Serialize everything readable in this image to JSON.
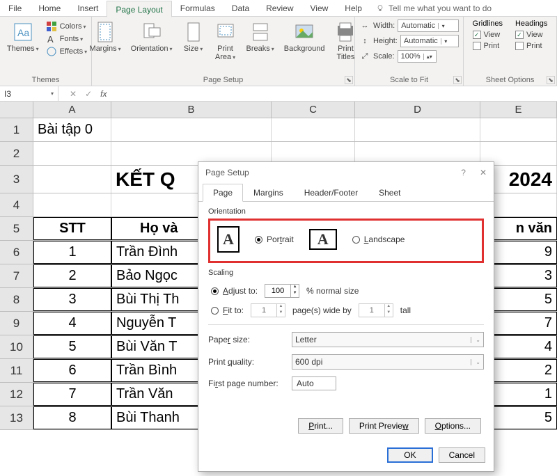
{
  "tabs": {
    "file": "File",
    "home": "Home",
    "insert": "Insert",
    "page_layout": "Page Layout",
    "formulas": "Formulas",
    "data": "Data",
    "review": "Review",
    "view": "View",
    "help": "Help",
    "tell_me": "Tell me what you want to do"
  },
  "ribbon": {
    "themes": {
      "themes_btn": "Themes",
      "colors": "Colors",
      "fonts": "Fonts",
      "effects": "Effects",
      "group": "Themes"
    },
    "page_setup": {
      "margins": "Margins",
      "orientation": "Orientation",
      "size": "Size",
      "print_area": "Print\nArea",
      "breaks": "Breaks",
      "background": "Background",
      "print_titles": "Print\nTitles",
      "group": "Page Setup"
    },
    "scale": {
      "width_lbl": "Width:",
      "width_val": "Automatic",
      "height_lbl": "Height:",
      "height_val": "Automatic",
      "scale_lbl": "Scale:",
      "scale_val": "100%",
      "group": "Scale to Fit"
    },
    "sheet_opts": {
      "gridlines": "Gridlines",
      "headings": "Headings",
      "view": "View",
      "print": "Print",
      "group": "Sheet Options"
    }
  },
  "formula_bar": {
    "namebox": "I3",
    "fx": "fx"
  },
  "cols": [
    "A",
    "B",
    "C",
    "D",
    "E"
  ],
  "rows": [
    "1",
    "2",
    "3",
    "4",
    "5",
    "6",
    "7",
    "8",
    "9",
    "10",
    "11",
    "12",
    "13"
  ],
  "cells": {
    "a1": "Bài tập 0",
    "title_left": "KẾT Q",
    "title_right": "2024",
    "hdr_stt": "STT",
    "hdr_ho": "Họ và",
    "hdr_van": "n văn",
    "data": [
      {
        "stt": "1",
        "ho": "Trần Đình",
        "v": "9"
      },
      {
        "stt": "2",
        "ho": "Bảo Ngọc",
        "v": "3"
      },
      {
        "stt": "3",
        "ho": "Bùi Thị Th",
        "v": "5"
      },
      {
        "stt": "4",
        "ho": "Nguyễn T",
        "v": "7"
      },
      {
        "stt": "5",
        "ho": "Bùi Văn T",
        "v": "4"
      },
      {
        "stt": "6",
        "ho": "Trần Bình",
        "v": "2"
      },
      {
        "stt": "7",
        "ho": "Trần Văn",
        "v": "1"
      },
      {
        "stt": "8",
        "ho": "Bùi Thanh",
        "v": "5"
      }
    ]
  },
  "dialog": {
    "title": "Page Setup",
    "help": "?",
    "close": "✕",
    "tabs": {
      "page": "Page",
      "margins": "Margins",
      "hf": "Header/Footer",
      "sheet": "Sheet"
    },
    "orientation": {
      "label": "Orientation",
      "portrait": "Portrait",
      "landscape": "Landscape",
      "letter": "A"
    },
    "scaling": {
      "label": "Scaling",
      "adjust": "Adjust to:",
      "adjust_val": "100",
      "adjust_suffix": "% normal size",
      "fit": "Fit to:",
      "fit_w": "1",
      "fit_mid": "page(s) wide by",
      "fit_h": "1",
      "fit_suffix": "tall"
    },
    "paper_size_lbl": "Paper size:",
    "paper_size_val": "Letter",
    "quality_lbl": "Print quality:",
    "quality_val": "600 dpi",
    "first_pg_lbl": "First page number:",
    "first_pg_val": "Auto",
    "btn_print": "Print...",
    "btn_preview": "Print Preview",
    "btn_options": "Options...",
    "ok": "OK",
    "cancel": "Cancel"
  }
}
